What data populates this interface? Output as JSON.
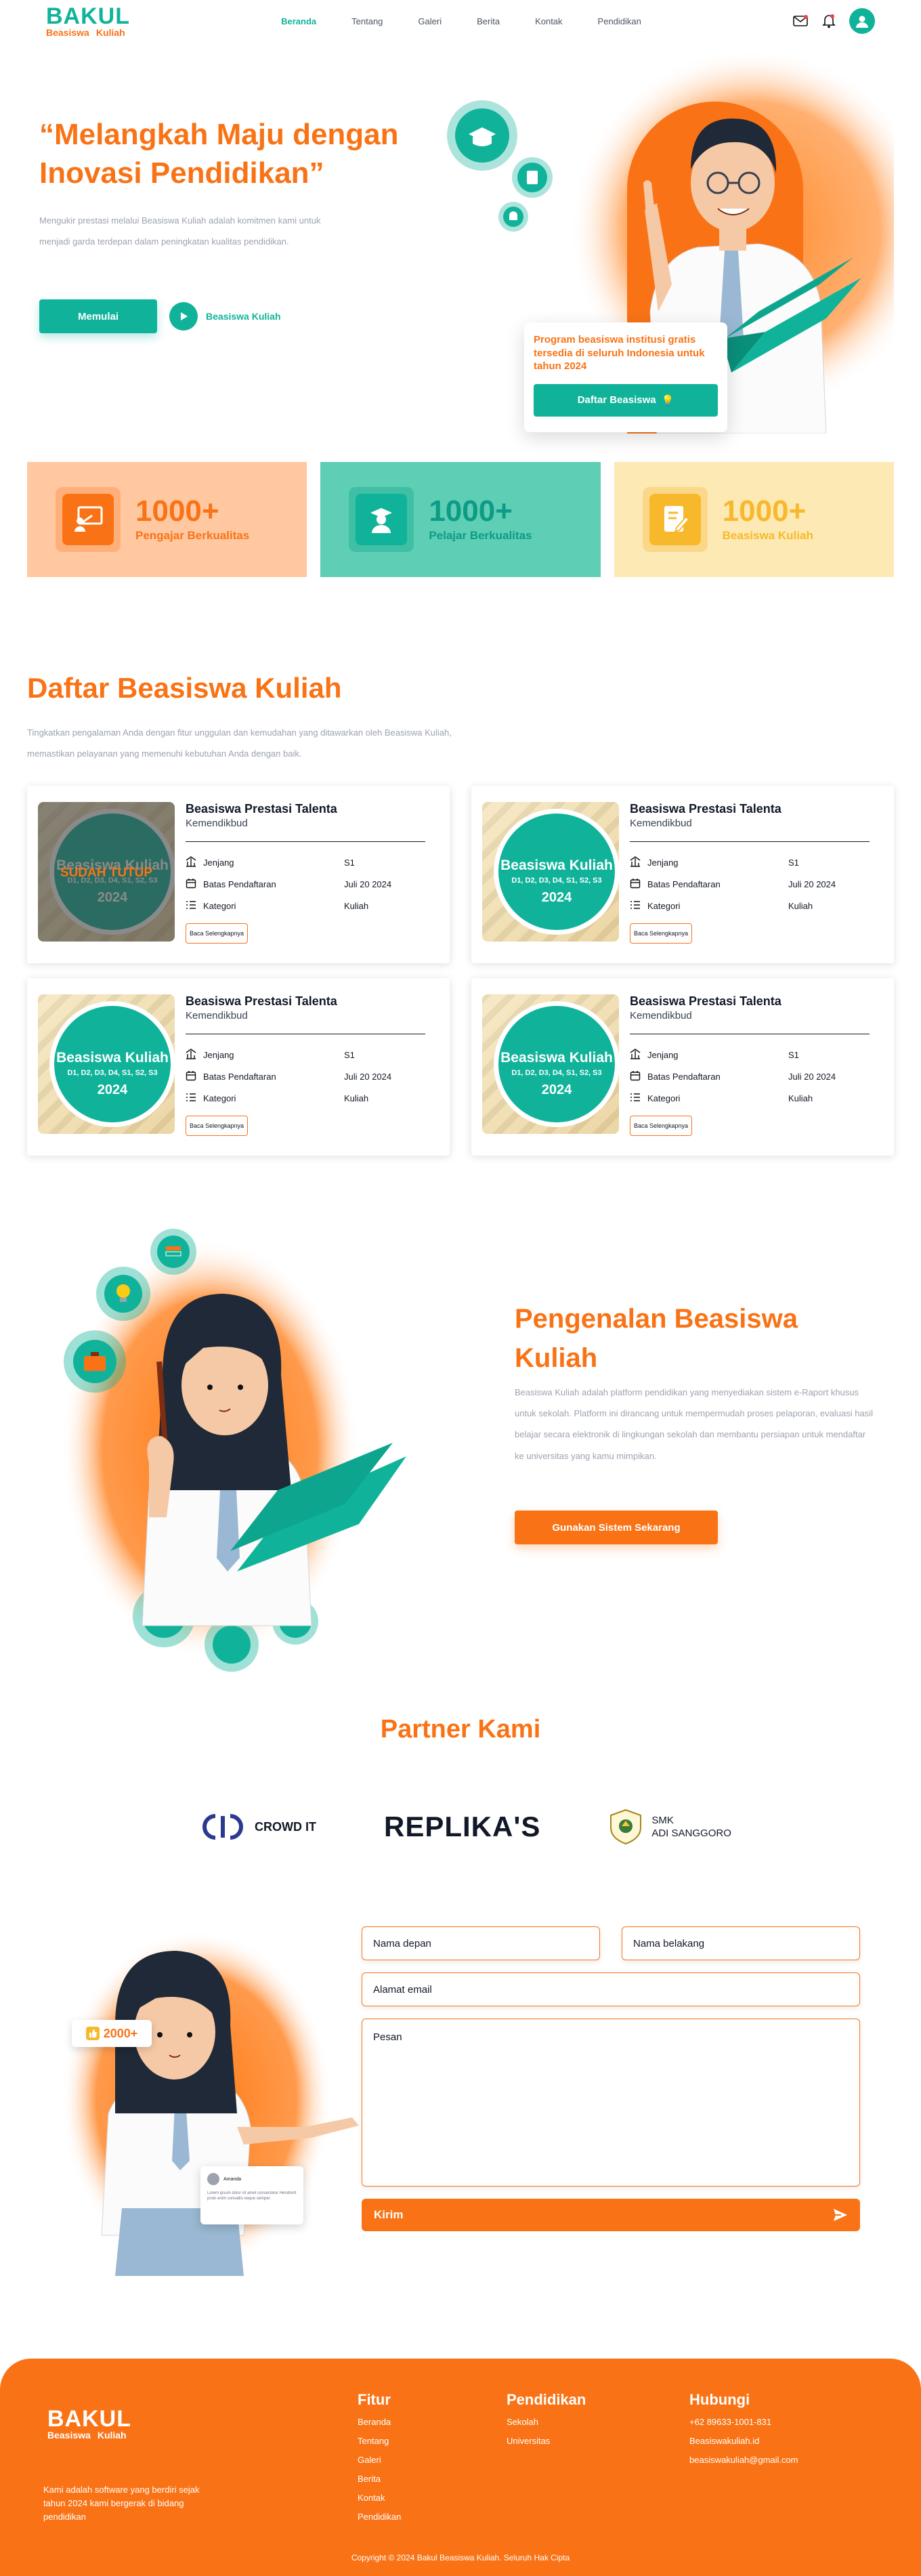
{
  "nav": {
    "logo": "BAKUL",
    "logo_sub_1": "Beasiswa",
    "logo_sub_2": "Kuliah",
    "links": [
      "Beranda",
      "Tentang",
      "Galeri",
      "Berita",
      "Kontak",
      "Pendidikan"
    ]
  },
  "hero": {
    "title": "“Melangkah Maju dengan Inovasi Pendidikan”",
    "description": "Mengukir prestasi melalui Beasiswa Kuliah adalah komitmen kami untuk menjadi garda terdepan dalam peningkatan kualitas pendidikan.",
    "start_button": "Memulai",
    "play_label": "Beasiswa Kuliah",
    "promo_text": "Program beasiswa institusi gratis tersedia di seluruh Indonesia untuk tahun 2024",
    "promo_button": "Daftar Beasiswa",
    "promo_emoji": "💡"
  },
  "stats": [
    {
      "value": "1000+",
      "label": "Pengajar Berkualitas",
      "bg": "#ffc8a0",
      "fg": "#f97316"
    },
    {
      "value": "1000+",
      "label": "Pelajar Berkualitas",
      "bg": "#5ecfb5",
      "fg": "#10b39a"
    },
    {
      "value": "1000+",
      "label": "Beasiswa Kuliah",
      "bg": "#fde9b4",
      "fg": "#f7b92b"
    }
  ],
  "scholarships": {
    "title": "Daftar Beasiswa Kuliah",
    "description": "Tingkatkan pengalaman Anda dengan fitur unggulan dan kemudahan yang ditawarkan oleh Beasiswa Kuliah, memastikan pelayanan yang memenuhi kebutuhan Anda dengan baik.",
    "thumb_title": "Beasiswa Kuliah",
    "thumb_codes": "D1, D2, D3, D4, S1, S2, S3",
    "thumb_year": "2024",
    "closed_label": "SUDAH TUTUP",
    "labels": {
      "level": "Jenjang",
      "deadline": "Batas Pendaftaran",
      "category": "Kategori"
    },
    "read_more": "Baca Selengkapnya",
    "items": [
      {
        "name": "Beasiswa Prestasi Talenta",
        "org": "Kemendikbud",
        "level": "S1",
        "deadline": "Juli 20 2024",
        "category": "Kuliah",
        "closed": true
      },
      {
        "name": "Beasiswa Prestasi Talenta",
        "org": "Kemendikbud",
        "level": "S1",
        "deadline": "Juli 20 2024",
        "category": "Kuliah",
        "closed": false
      },
      {
        "name": "Beasiswa Prestasi Talenta",
        "org": "Kemendikbud",
        "level": "S1",
        "deadline": "Juli 20 2024",
        "category": "Kuliah",
        "closed": false
      },
      {
        "name": "Beasiswa Prestasi Talenta",
        "org": "Kemendikbud",
        "level": "S1",
        "deadline": "Juli 20 2024",
        "category": "Kuliah",
        "closed": false
      }
    ]
  },
  "intro": {
    "title": "Pengenalan Beasiswa Kuliah",
    "description": "Beasiswa Kuliah adalah platform pendidikan yang menyediakan sistem e-Raport khusus untuk sekolah. Platform ini dirancang untuk mempermudah proses pelaporan, evaluasi hasil belajar secara elektronik di lingkungan sekolah dan membantu persiapan untuk mendaftar ke universitas yang kamu mimpikan.",
    "button": "Gunakan Sistem Sekarang"
  },
  "partners": {
    "title": "Partner Kami",
    "crowd": "CROWD IT",
    "replikas": "REPLIKA'S",
    "smk_1": "SMK",
    "smk_2": "ADI SANGGORO"
  },
  "contact": {
    "first_name": "Nama depan",
    "last_name": "Nama belakang",
    "email": "Alamat email",
    "message": "Pesan",
    "send": "Kirim",
    "badge": "2000+",
    "mini_name": "Amanda",
    "mini_text": "Lorem ipsum dolor sit amet consectetur Hendrerit proin enim convallis neque semper."
  },
  "footer": {
    "about": "Kami adalah software yang berdiri sejak tahun 2024 kami bergerak di bidang pendidikan",
    "fitur_title": "Fitur",
    "fitur": [
      "Beranda",
      "Tentang",
      "Galeri",
      "Berita",
      "Kontak",
      "Pendidikan"
    ],
    "pendidikan_title": "Pendidikan",
    "pendidikan": [
      "Sekolah",
      "Universitas"
    ],
    "hubungi_title": "Hubungi",
    "hubungi": [
      "+62 89633-1001-831",
      "Beasiswakuliah.id",
      "beasiswakuliah@gmail.com"
    ],
    "copyright": "Copyright © 2024 Bakul Beasiswa Kuliah. Seluruh Hak Cipta"
  },
  "colors": {
    "primary": "#10b39a",
    "accent": "#f97316"
  }
}
